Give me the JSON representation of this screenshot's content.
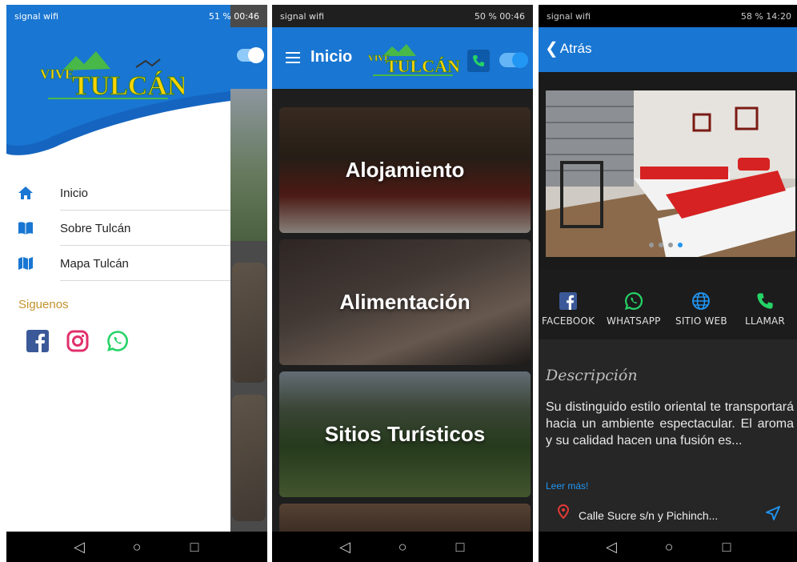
{
  "status_bars": [
    {
      "left": "signal wifi",
      "right": "51 % 00:46"
    },
    {
      "left": "signal wifi",
      "right": "50 % 00:46"
    },
    {
      "left": "signal wifi",
      "right": "58 % 14:20"
    }
  ],
  "logo": {
    "top": "VIVE",
    "bottom": "TULCÁN"
  },
  "drawer": {
    "items": [
      {
        "label": "Inicio",
        "icon": "home-icon"
      },
      {
        "label": "Sobre Tulcán",
        "icon": "book-icon"
      },
      {
        "label": "Mapa Tulcán",
        "icon": "map-icon"
      }
    ],
    "siguenos": "Siguenos",
    "social": [
      "facebook-icon",
      "instagram-icon",
      "whatsapp-icon"
    ]
  },
  "home": {
    "title": "Inicio",
    "categories": [
      {
        "label": "Alojamiento"
      },
      {
        "label": "Alimentación"
      },
      {
        "label": "Sitios Turísticos"
      }
    ]
  },
  "detail": {
    "back": "Atrás",
    "actions": [
      {
        "label": "FACEBOOK",
        "icon": "facebook-icon"
      },
      {
        "label": "WHATSAPP",
        "icon": "whatsapp-icon"
      },
      {
        "label": "SITIO WEB",
        "icon": "globe-icon"
      },
      {
        "label": "LLAMAR",
        "icon": "phone-icon"
      }
    ],
    "description_title": "Descripción",
    "description": "Su distinguido estilo oriental te transportará hacia un ambiente espectacular. El aroma y su calidad hacen una fusión es...",
    "read_more": "Leer más!",
    "address": "Calle Sucre s/n y Pichinch..."
  },
  "nav": {
    "back": "◁",
    "home": "○",
    "recents": "□"
  },
  "colors": {
    "primary": "#1976d2",
    "accent": "#2196f3",
    "gold": "#c3922b",
    "whatsapp": "#25d366",
    "facebook": "#3b5998"
  }
}
